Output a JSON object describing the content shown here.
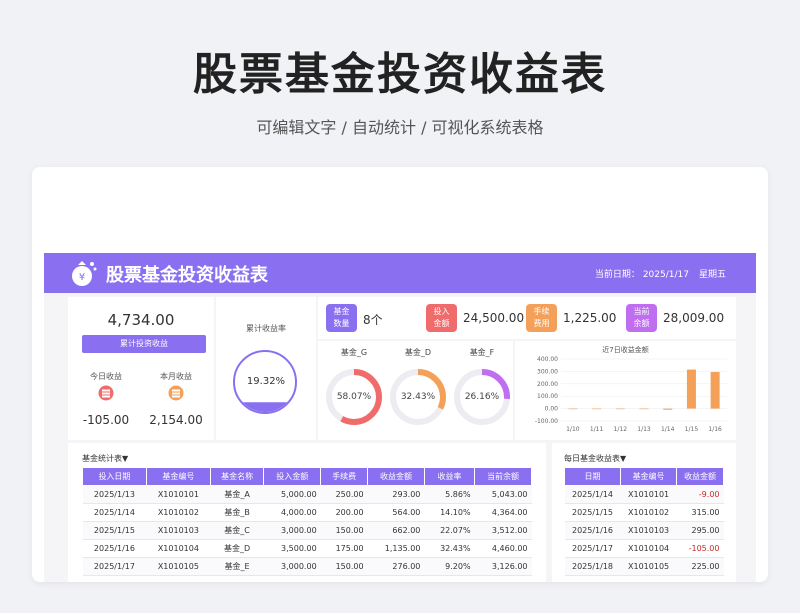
{
  "hero": {
    "title": "股票基金投资收益表",
    "subtitle": "可编辑文字 / 自动统计 / 可视化系统表格"
  },
  "header": {
    "title": "股票基金投资收益表",
    "date_label": "当前日期：",
    "date": "2025/1/17",
    "weekday": "星期五"
  },
  "summary": {
    "total_value": "4,734.00",
    "total_button": "累计投资收益",
    "today_label": "今日收益",
    "today_value": "-105.00",
    "month_label": "本月收益",
    "month_value": "2,154.00",
    "cum_rate_label": "累计收益率",
    "cum_rate_value": "19.32%",
    "cum_rate_fraction": 0.1932
  },
  "kpis": [
    {
      "label_line1": "基金",
      "label_line2": "数量",
      "value": "8个",
      "color": "#8a70f0"
    },
    {
      "label_line1": "投入",
      "label_line2": "金额",
      "value": "24,500.00",
      "color": "#f06b6b"
    },
    {
      "label_line1": "手续",
      "label_line2": "费用",
      "value": "1,225.00",
      "color": "#f5a058"
    },
    {
      "label_line1": "当前",
      "label_line2": "余额",
      "value": "28,009.00",
      "color": "#c06ef0"
    }
  ],
  "gauges": [
    {
      "name": "基金_G",
      "value": "58.07%",
      "fraction": 0.5807,
      "color": "#f06b6b"
    },
    {
      "name": "基金_D",
      "value": "32.43%",
      "fraction": 0.3243,
      "color": "#f5a058"
    },
    {
      "name": "基金_F",
      "value": "26.16%",
      "fraction": 0.2616,
      "color": "#c06ef0"
    }
  ],
  "chart_data": {
    "type": "bar",
    "title": "近7日收益金额",
    "categories": [
      "1/10",
      "1/11",
      "1/12",
      "1/13",
      "1/14",
      "1/15",
      "1/16"
    ],
    "values": [
      0,
      0,
      0,
      0,
      -9,
      315,
      295
    ],
    "yticks": [
      "400.00",
      "300.00",
      "200.00",
      "100.00",
      "0.00",
      "-100.00"
    ],
    "ylim": [
      -100,
      400
    ],
    "color": "#f5a058"
  },
  "stats_table": {
    "title": "基金统计表▼",
    "headers": [
      "投入日期",
      "基金编号",
      "基金名称",
      "投入金额",
      "手续费",
      "收益金额",
      "收益率",
      "当前余额"
    ],
    "rows": [
      [
        "2025/1/13",
        "X1010101",
        "基金_A",
        "5,000.00",
        "250.00",
        "293.00",
        "5.86%",
        "5,043.00"
      ],
      [
        "2025/1/14",
        "X1010102",
        "基金_B",
        "4,000.00",
        "200.00",
        "564.00",
        "14.10%",
        "4,364.00"
      ],
      [
        "2025/1/15",
        "X1010103",
        "基金_C",
        "3,000.00",
        "150.00",
        "662.00",
        "22.07%",
        "3,512.00"
      ],
      [
        "2025/1/16",
        "X1010104",
        "基金_D",
        "3,500.00",
        "175.00",
        "1,135.00",
        "32.43%",
        "4,460.00"
      ],
      [
        "2025/1/17",
        "X1010105",
        "基金_E",
        "3,000.00",
        "150.00",
        "276.00",
        "9.20%",
        "3,126.00"
      ]
    ]
  },
  "daily_table": {
    "title": "每日基金收益表▼",
    "headers": [
      "日期",
      "基金编号",
      "收益金额"
    ],
    "rows": [
      [
        "2025/1/14",
        "X1010101",
        "-9.00"
      ],
      [
        "2025/1/15",
        "X1010102",
        "315.00"
      ],
      [
        "2025/1/16",
        "X1010103",
        "295.00"
      ],
      [
        "2025/1/17",
        "X1010104",
        "-105.00"
      ],
      [
        "2025/1/18",
        "X1010105",
        "225.00"
      ]
    ]
  }
}
